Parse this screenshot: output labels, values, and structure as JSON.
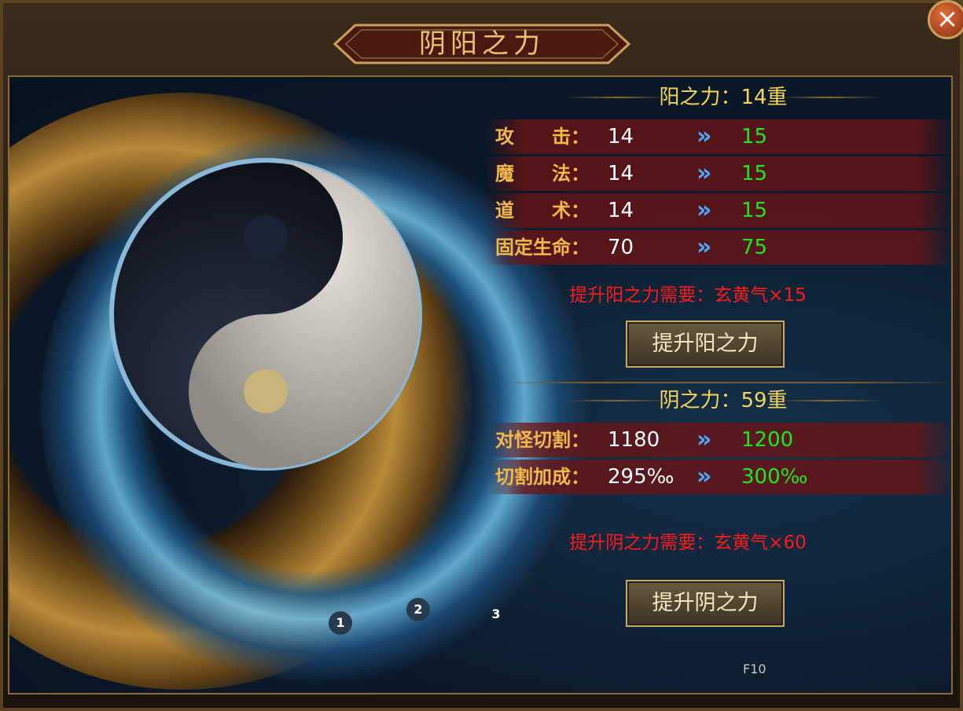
{
  "window": {
    "title": "阴阳之力",
    "close_label": "×"
  },
  "yang": {
    "header": "阳之力：14重",
    "stats": [
      {
        "label": "攻　　击：",
        "current": "14",
        "next": "15"
      },
      {
        "label": "魔　　法：",
        "current": "14",
        "next": "15"
      },
      {
        "label": "道　　术：",
        "current": "14",
        "next": "15"
      },
      {
        "label": "固定生命：",
        "current": "70",
        "next": "75"
      }
    ],
    "requirement": "提升阳之力需要：玄黄气×15",
    "button": "提升阳之力"
  },
  "yin": {
    "header": "阴之力：59重",
    "stats": [
      {
        "label": "对怪切割：",
        "current": "1180",
        "next": "1200"
      },
      {
        "label": "切割加成：",
        "current": "295‰",
        "next": "300‰"
      }
    ],
    "requirement": "提升阴之力需要：玄黄气×60",
    "button": "提升阴之力"
  },
  "pages": [
    "1",
    "2",
    "3"
  ],
  "hotkey": "F10",
  "arrow_glyph": "»",
  "colors": {
    "current_value": "#ffffff",
    "next_value": "#22e51f",
    "requirement": "#ff1a1a",
    "header": "#f4d45a",
    "label": "#f2b84a"
  }
}
